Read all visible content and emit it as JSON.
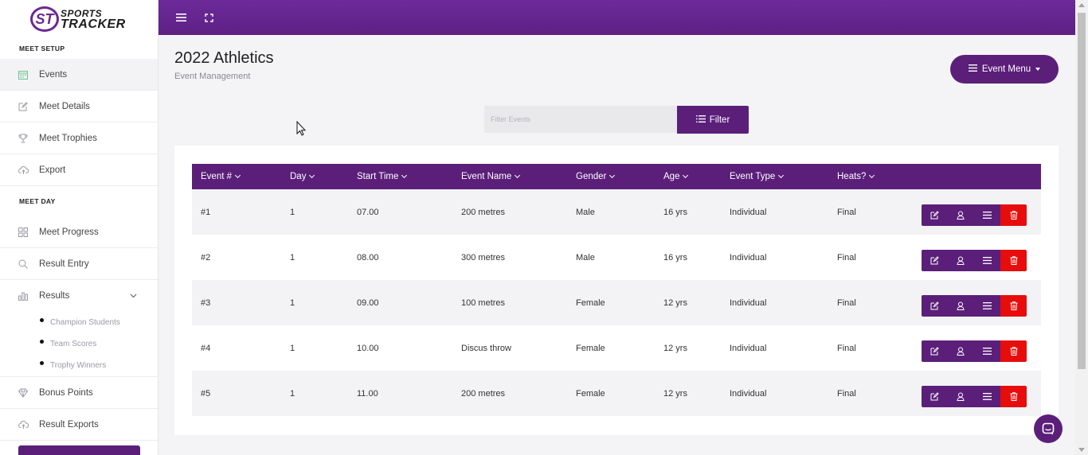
{
  "app": {
    "logo_line1": "SPORTS",
    "logo_line2": "TRACKER",
    "logo_mark": "ST"
  },
  "sidebar": {
    "section_setup": "MEET SETUP",
    "section_day": "MEET DAY",
    "setup_items": [
      {
        "label": "Events",
        "icon": "calendar-icon",
        "active": true
      },
      {
        "label": "Meet Details",
        "icon": "edit-icon"
      },
      {
        "label": "Meet Trophies",
        "icon": "trophy-icon"
      },
      {
        "label": "Export",
        "icon": "cloud-upload-icon"
      }
    ],
    "day_items": [
      {
        "label": "Meet Progress",
        "icon": "grid-icon"
      },
      {
        "label": "Result Entry",
        "icon": "search-icon"
      },
      {
        "label": "Results",
        "icon": "bar-chart-icon",
        "expanded": true
      }
    ],
    "results_sub": [
      {
        "label": "Champion Students"
      },
      {
        "label": "Team Scores"
      },
      {
        "label": "Trophy Winners"
      }
    ],
    "bottom_items": [
      {
        "label": "Bonus Points",
        "icon": "diamond-icon"
      },
      {
        "label": "Result Exports",
        "icon": "cloud-upload-icon"
      }
    ]
  },
  "header": {
    "title": "2022 Athletics",
    "subtitle": "Event Management",
    "event_menu_label": "Event Menu"
  },
  "filter": {
    "placeholder": "Filter Events",
    "button_label": "Filter"
  },
  "table": {
    "columns": [
      "Event #",
      "Day",
      "Start Time",
      "Event Name",
      "Gender",
      "Age",
      "Event Type",
      "Heats?"
    ],
    "rows": [
      {
        "num": "#1",
        "day": "1",
        "start": "07.00",
        "name": "200 metres",
        "gender": "Male",
        "age": "16 yrs",
        "type": "Individual",
        "heats": "Final"
      },
      {
        "num": "#2",
        "day": "1",
        "start": "08.00",
        "name": "300 metres",
        "gender": "Male",
        "age": "16 yrs",
        "type": "Individual",
        "heats": "Final"
      },
      {
        "num": "#3",
        "day": "1",
        "start": "09.00",
        "name": "100 metres",
        "gender": "Female",
        "age": "12 yrs",
        "type": "Individual",
        "heats": "Final"
      },
      {
        "num": "#4",
        "day": "1",
        "start": "10.00",
        "name": "Discus throw",
        "gender": "Female",
        "age": "12 yrs",
        "type": "Individual",
        "heats": "Final"
      },
      {
        "num": "#5",
        "day": "1",
        "start": "11.00",
        "name": "200 metres",
        "gender": "Female",
        "age": "12 yrs",
        "type": "Individual",
        "heats": "Final"
      }
    ]
  },
  "colors": {
    "brand_purple": "#5b1f7a",
    "delete_red": "#e80d0d",
    "active_icon_green": "#6fc48e"
  }
}
